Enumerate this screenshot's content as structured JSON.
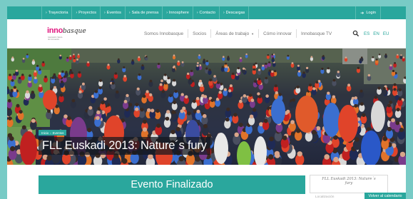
{
  "topnav": {
    "items": [
      {
        "label": "Trayectoria"
      },
      {
        "label": "Proyectos"
      },
      {
        "label": "Eventos"
      },
      {
        "label": "Sala de prensa"
      },
      {
        "label": "Innosphere"
      },
      {
        "label": "Contacto"
      },
      {
        "label": "Descargas"
      }
    ],
    "login_label": "Login"
  },
  "header": {
    "logo_main": "inno",
    "logo_basque": "basque",
    "logo_tagline_1": "Asociación Vasca",
    "logo_tagline_2": "de Innovación",
    "nav": [
      {
        "label": "Somos Innobasque"
      },
      {
        "label": "Socios"
      },
      {
        "label": "Áreas de trabajo"
      },
      {
        "label": "Cómo innovar"
      },
      {
        "label": "Innobasque TV"
      }
    ],
    "languages": [
      {
        "label": "ES"
      },
      {
        "label": "EN"
      },
      {
        "label": "EU"
      }
    ]
  },
  "hero": {
    "breadcrumb": [
      "Inicio",
      "Eventos"
    ],
    "title": "FLL Euskadi 2013: Nature´s fury"
  },
  "status": {
    "label": "Evento Finalizado"
  },
  "sidebar": {
    "card_title_1": "FLL Euskadi 2013: Nature´s",
    "card_title_2": "fury",
    "location_label": "Localización",
    "back_label": "Volver al calendario"
  },
  "colors": {
    "teal": "#2aa79d",
    "background": "#78cbc6",
    "brand_pink": "#e0137d"
  }
}
